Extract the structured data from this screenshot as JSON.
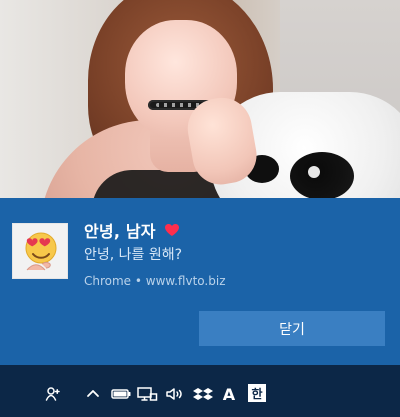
{
  "notification": {
    "title": "안녕, 남자",
    "message": "안녕, 나를 원해?",
    "source": "Chrome • www.flvto.biz",
    "button_label": "닫기",
    "title_emoji": "heart-icon",
    "app_icon": "heart-eyes-emoji-icon"
  },
  "taskbar": {
    "tray_icons": [
      "people-icon",
      "chevron-up-icon",
      "battery-icon",
      "network-icon",
      "volume-icon",
      "dropbox-icon"
    ],
    "font_indicator": "A",
    "ime_label": "한"
  },
  "colors": {
    "toast_bg": "#1b63a8",
    "button_bg": "#3a7fc2",
    "taskbar_bg": "#0c2747"
  }
}
